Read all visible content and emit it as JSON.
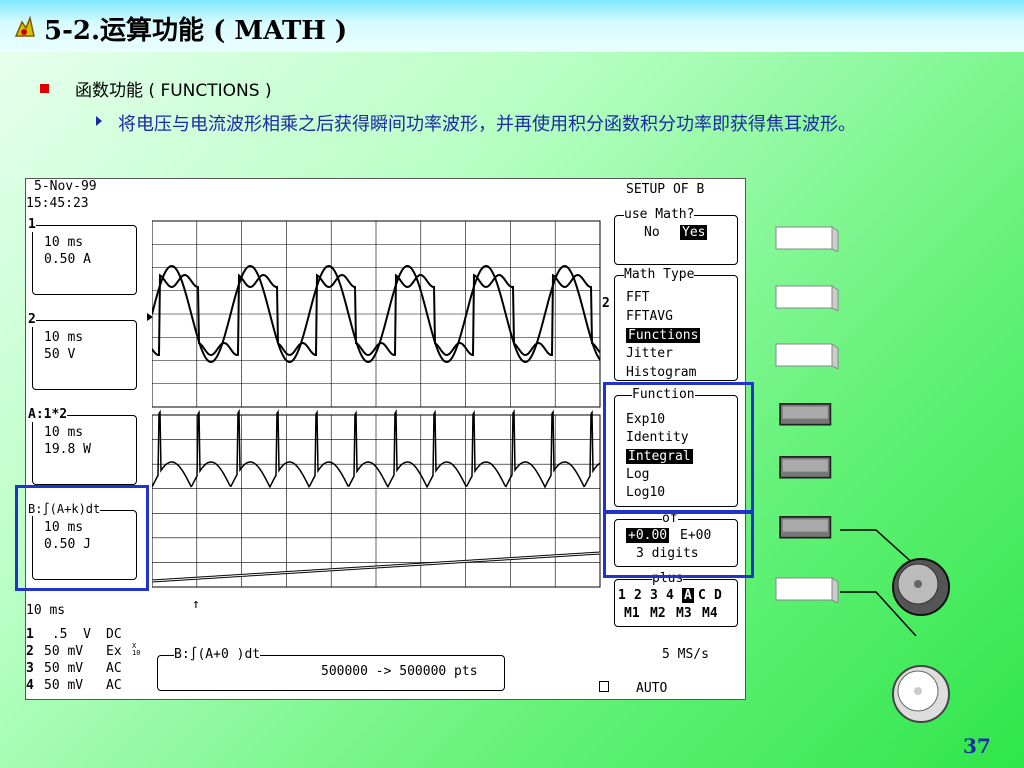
{
  "slide": {
    "title": "5-2.运算功能 ( MATH )",
    "bullet1": "函数功能 ( FUNCTIONS )",
    "bullet2": "将电压与电流波形相乘之后获得瞬间功率波形，并再使用积分函数积分功率即获得焦耳波形。",
    "page_number": "37"
  },
  "scope": {
    "date": "5-Nov-99",
    "time": "15:45:23",
    "channels": [
      {
        "tag": "1",
        "timebase": "10 ms",
        "scale": "0.50 A"
      },
      {
        "tag": "2",
        "timebase": "10 ms",
        "scale": "50 V"
      },
      {
        "tag": "A:1*2",
        "timebase": "10 ms",
        "scale": "19.8 W"
      },
      {
        "tag": "B:∫(A+k)dt",
        "timebase": "10 ms",
        "scale": "0.50 J"
      }
    ],
    "bottom_timebase": "10 ms",
    "input_rows": [
      {
        "ch": "1",
        "value": " .5  V",
        "coupling": "DC"
      },
      {
        "ch": "2",
        "value": "50 mV",
        "coupling": "Ex"
      },
      {
        "ch": "3",
        "value": "50 mV",
        "coupling": "AC"
      },
      {
        "ch": "4",
        "value": "50 mV",
        "coupling": "AC"
      }
    ],
    "ex_note": "X\n10",
    "formula": "B:∫(A+0 )dt",
    "points": "500000 -> 500000 pts",
    "sample_rate": "5 MS/s",
    "trigger_mode": "AUTO",
    "marker_2": "2",
    "menu": {
      "header": "SETUP OF B",
      "use_math": {
        "label": "use Math?",
        "no": "No",
        "yes": "Yes"
      },
      "math_type": {
        "label": "Math Type",
        "items": [
          "FFT",
          "FFTAVG",
          "Functions",
          "Jitter",
          "Histogram"
        ],
        "selected": "Functions"
      },
      "function": {
        "label": "Function",
        "items": [
          "Exp10",
          "Identity",
          "Integral",
          "Log",
          "Log10"
        ],
        "selected": "Integral"
      },
      "of": {
        "label": "of",
        "value": "+0.00",
        "exp": "E+00",
        "digits": "3 digits"
      },
      "plus": {
        "label": "plus",
        "row1": [
          "1",
          "2",
          "3",
          "4",
          "A",
          "C",
          "D"
        ],
        "row2": [
          "M1",
          "M2",
          "M3",
          "M4"
        ],
        "selected": "A"
      }
    }
  }
}
